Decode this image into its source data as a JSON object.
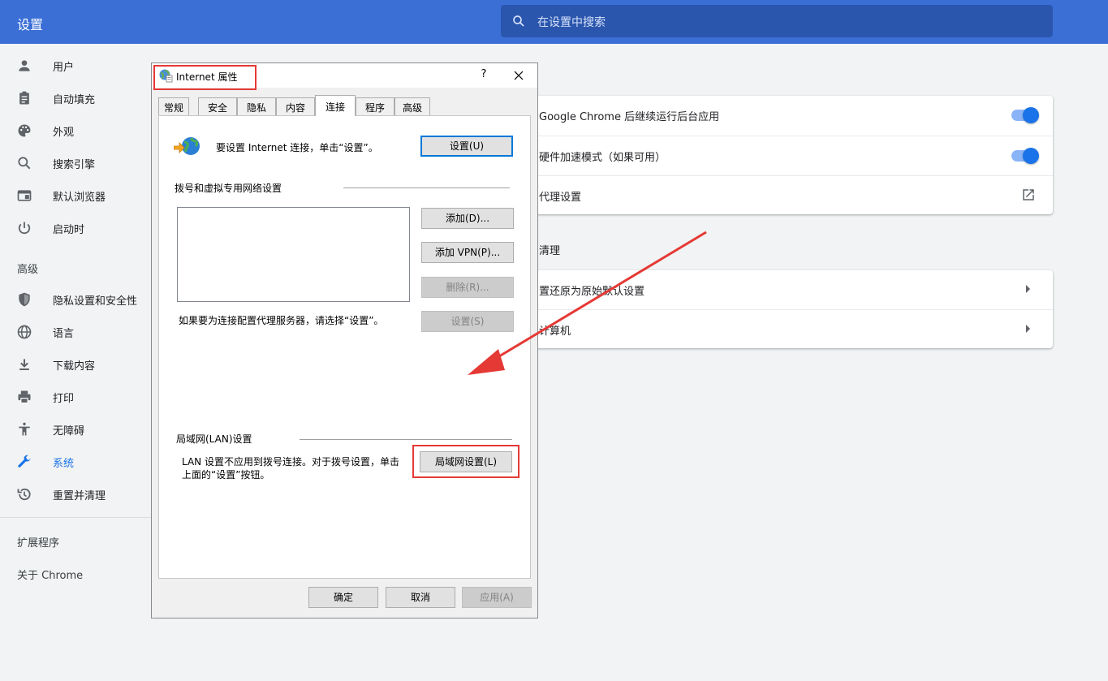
{
  "header": {
    "title": "设置",
    "search_placeholder": "在设置中搜索"
  },
  "sidebar": {
    "items": [
      {
        "label": "用户",
        "icon": "person-icon"
      },
      {
        "label": "自动填充",
        "icon": "clipboard-icon"
      },
      {
        "label": "外观",
        "icon": "palette-icon"
      },
      {
        "label": "搜索引擎",
        "icon": "search-icon"
      },
      {
        "label": "默认浏览器",
        "icon": "browser-icon"
      },
      {
        "label": "启动时",
        "icon": "power-icon"
      }
    ],
    "advanced_heading": "高级",
    "advanced_items": [
      {
        "label": "隐私设置和安全性",
        "icon": "shield-icon"
      },
      {
        "label": "语言",
        "icon": "globe-icon"
      },
      {
        "label": "下载内容",
        "icon": "download-icon"
      },
      {
        "label": "打印",
        "icon": "printer-icon"
      },
      {
        "label": "无障碍",
        "icon": "accessibility-icon"
      },
      {
        "label": "系统",
        "icon": "wrench-icon",
        "active": true
      },
      {
        "label": "重置并清理",
        "icon": "history-icon"
      }
    ],
    "extensions": "扩展程序",
    "about": "关于 Chrome",
    "active_color": "#1a73e8"
  },
  "system_card": {
    "row1": "Google Chrome 后继续运行后台应用",
    "row2": "硬件加速模式（如果可用）",
    "row3": "代理设置"
  },
  "reset_section": {
    "heading": "清理",
    "row1": "置还原为原始默认设置",
    "row2": "计算机"
  },
  "dialog": {
    "title": "Internet 属性",
    "help": "?",
    "tabs": [
      "常规",
      "安全",
      "隐私",
      "内容",
      "连接",
      "程序",
      "高级"
    ],
    "selected_tab": "连接",
    "setup_text": "要设置 Internet 连接，单击“设置”。",
    "setup_button": "设置(U)",
    "dialup_heading": "拨号和虚拟专用网络设置",
    "add_button": "添加(D)...",
    "add_vpn_button": "添加 VPN(P)...",
    "remove_button": "删除(R)...",
    "settings_button": "设置(S)",
    "proxy_text": "如果要为连接配置代理服务器，请选择“设置”。",
    "lan_heading": "局域网(LAN)设置",
    "lan_text_line1": "LAN 设置不应用到拨号连接。对于拨号设置，单击",
    "lan_text_line2": "上面的“设置”按钮。",
    "lan_button": "局域网设置(L)",
    "ok_button": "确定",
    "cancel_button": "取消",
    "apply_button": "应用(A)"
  },
  "annotation_color": "#e53935"
}
